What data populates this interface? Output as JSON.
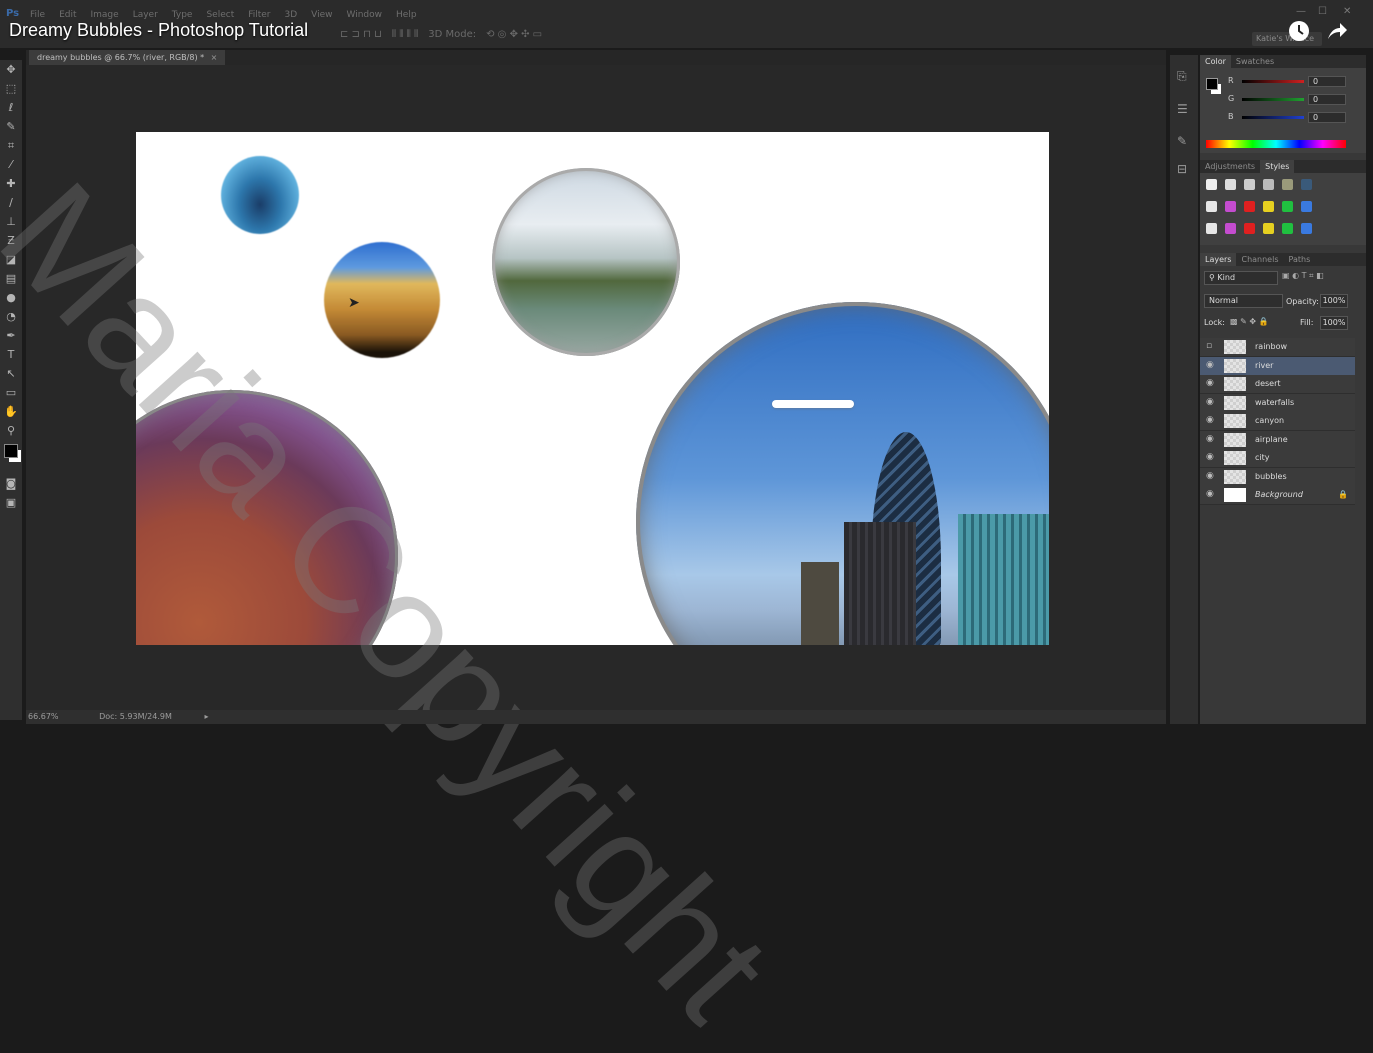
{
  "video": {
    "title": "Dreamy Bubbles - Photoshop Tutorial",
    "watch_later_icon": "clock-icon",
    "share_icon": "share-arrow-icon"
  },
  "app": {
    "logo": "Ps",
    "menu": [
      "File",
      "Edit",
      "Image",
      "Layer",
      "Type",
      "Select",
      "Filter",
      "3D",
      "View",
      "Window",
      "Help"
    ],
    "options_bar": {
      "mode_label": "3D Mode:"
    },
    "workspace_name": "Katie's W...ace",
    "window_controls": [
      "—",
      "☐",
      "✕"
    ]
  },
  "document": {
    "tab_label": "dreamy bubbles @ 66.7% (river, RGB/8) *",
    "tab_close": "×"
  },
  "status": {
    "zoom": "66.67%",
    "doc_size": "Doc: 5.93M/24.9M"
  },
  "watermark": "Maria Copyright",
  "panels": {
    "color": {
      "tabs": [
        "Color",
        "Swatches"
      ],
      "channels": [
        {
          "label": "R",
          "value": "0",
          "color": "#d02020"
        },
        {
          "label": "G",
          "value": "0",
          "color": "#20a030"
        },
        {
          "label": "B",
          "value": "0",
          "color": "#2040d0"
        }
      ]
    },
    "styles": {
      "tabs": [
        "Adjustments",
        "Styles"
      ]
    },
    "layers": {
      "tabs": [
        "Layers",
        "Channels",
        "Paths"
      ],
      "filter_kind": "Kind",
      "blend_mode": "Normal",
      "opacity_label": "Opacity:",
      "opacity_value": "100%",
      "lock_label": "Lock:",
      "fill_label": "Fill:",
      "fill_value": "100%",
      "items": [
        {
          "name": "rainbow",
          "visible": false,
          "selected": false
        },
        {
          "name": "river",
          "visible": true,
          "selected": true
        },
        {
          "name": "desert",
          "visible": true,
          "selected": false
        },
        {
          "name": "waterfalls",
          "visible": true,
          "selected": false
        },
        {
          "name": "canyon",
          "visible": true,
          "selected": false
        },
        {
          "name": "airplane",
          "visible": true,
          "selected": false
        },
        {
          "name": "city",
          "visible": true,
          "selected": false
        },
        {
          "name": "bubbles",
          "visible": true,
          "selected": false
        },
        {
          "name": "Background",
          "visible": true,
          "selected": false
        }
      ]
    }
  }
}
